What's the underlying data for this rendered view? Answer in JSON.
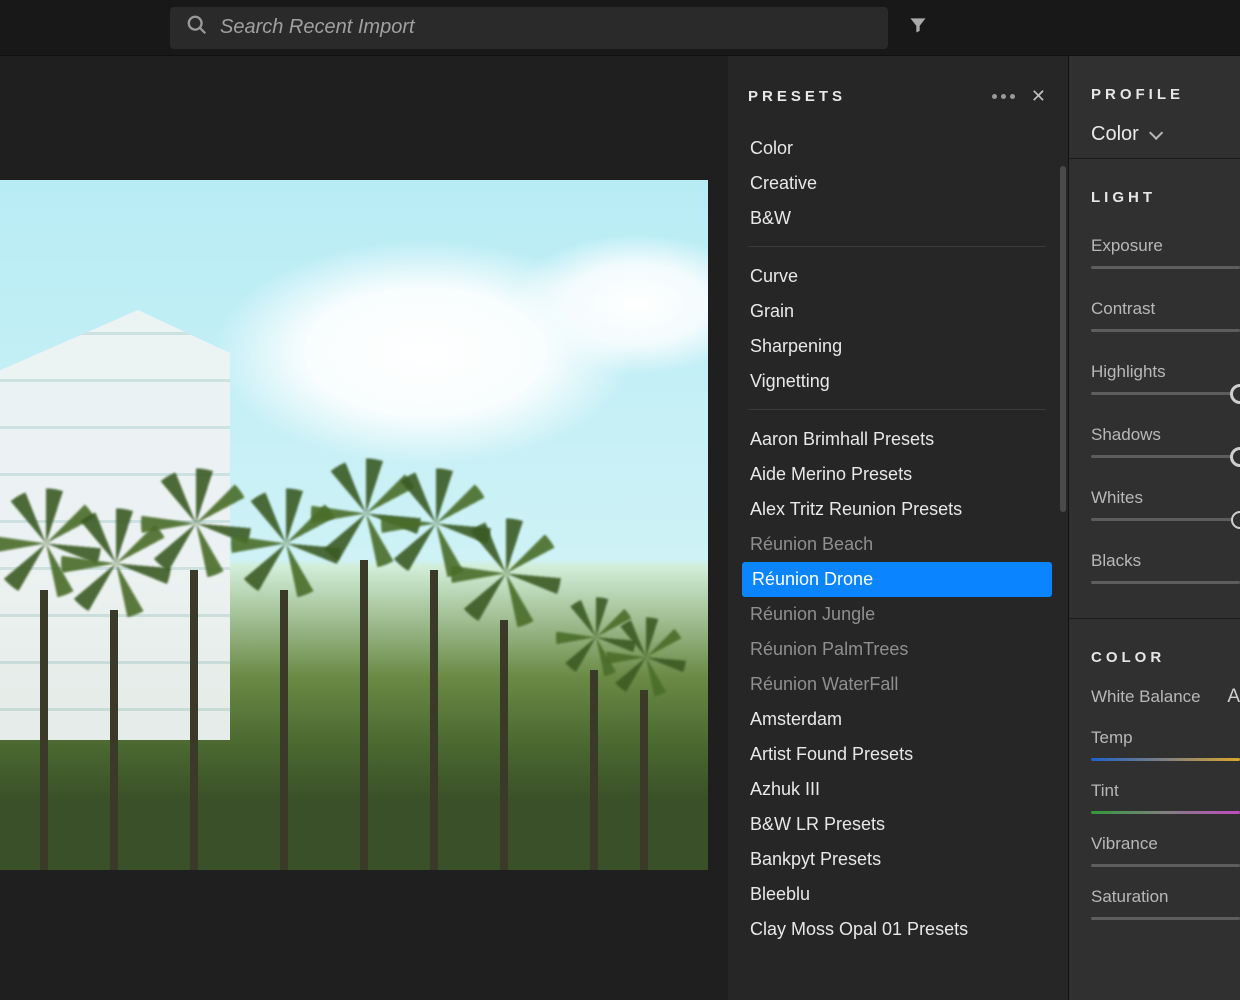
{
  "search": {
    "placeholder": "Search Recent Import"
  },
  "presets": {
    "title": "PRESETS",
    "groups": [
      {
        "items": [
          {
            "label": "Color"
          },
          {
            "label": "Creative"
          },
          {
            "label": "B&W"
          }
        ]
      },
      {
        "items": [
          {
            "label": "Curve"
          },
          {
            "label": "Grain"
          },
          {
            "label": "Sharpening"
          },
          {
            "label": "Vignetting"
          }
        ]
      },
      {
        "items": [
          {
            "label": "Aaron Brimhall Presets"
          },
          {
            "label": "Aide Merino Presets"
          },
          {
            "label": "Alex Tritz Reunion Presets"
          },
          {
            "label": "Réunion Beach",
            "dim": true
          },
          {
            "label": "Réunion Drone",
            "selected": true
          },
          {
            "label": "Réunion Jungle",
            "dim": true
          },
          {
            "label": "Réunion PalmTrees",
            "dim": true
          },
          {
            "label": "Réunion WaterFall",
            "dim": true
          },
          {
            "label": "Amsterdam"
          },
          {
            "label": "Artist Found Presets"
          },
          {
            "label": "Azhuk III"
          },
          {
            "label": "B&W LR Presets"
          },
          {
            "label": "Bankpyt Presets"
          },
          {
            "label": "Bleeblu"
          },
          {
            "label": "Clay Moss Opal 01 Presets"
          }
        ]
      }
    ]
  },
  "edit": {
    "profile": {
      "title": "PROFILE",
      "value": "Color"
    },
    "light": {
      "title": "LIGHT",
      "sliders": [
        {
          "label": "Exposure"
        },
        {
          "label": "Contrast"
        },
        {
          "label": "Highlights",
          "knob": 1.0,
          "big": true
        },
        {
          "label": "Shadows",
          "knob": 1.0,
          "big": true
        },
        {
          "label": "Whites",
          "knob": 1.0
        },
        {
          "label": "Blacks"
        }
      ]
    },
    "color": {
      "title": "COLOR",
      "wb_label": "White Balance",
      "wb_value": "A",
      "sliders": [
        {
          "label": "Temp",
          "grad": "temp"
        },
        {
          "label": "Tint",
          "grad": "tint"
        },
        {
          "label": "Vibrance"
        },
        {
          "label": "Saturation"
        }
      ]
    }
  }
}
